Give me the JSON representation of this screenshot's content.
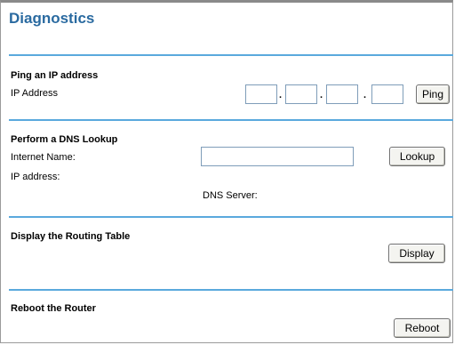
{
  "page": {
    "title": "Diagnostics"
  },
  "ping": {
    "section_title": "Ping an IP address",
    "ip_label": "IP Address",
    "octets": [
      "",
      "",
      "",
      ""
    ],
    "separator": ".",
    "button_label": "Ping"
  },
  "dns": {
    "section_title": "Perform a DNS Lookup",
    "internet_name_label": "Internet Name:",
    "internet_name_value": "",
    "ip_address_label": "IP address:",
    "dns_server_label": "DNS Server:",
    "button_label": "Lookup"
  },
  "routing": {
    "section_title": "Display the Routing Table",
    "button_label": "Display"
  },
  "reboot": {
    "section_title": "Reboot the Router",
    "button_label": "Reboot"
  },
  "colors": {
    "title": "#2a6aa0",
    "divider": "#5aa9dd"
  }
}
